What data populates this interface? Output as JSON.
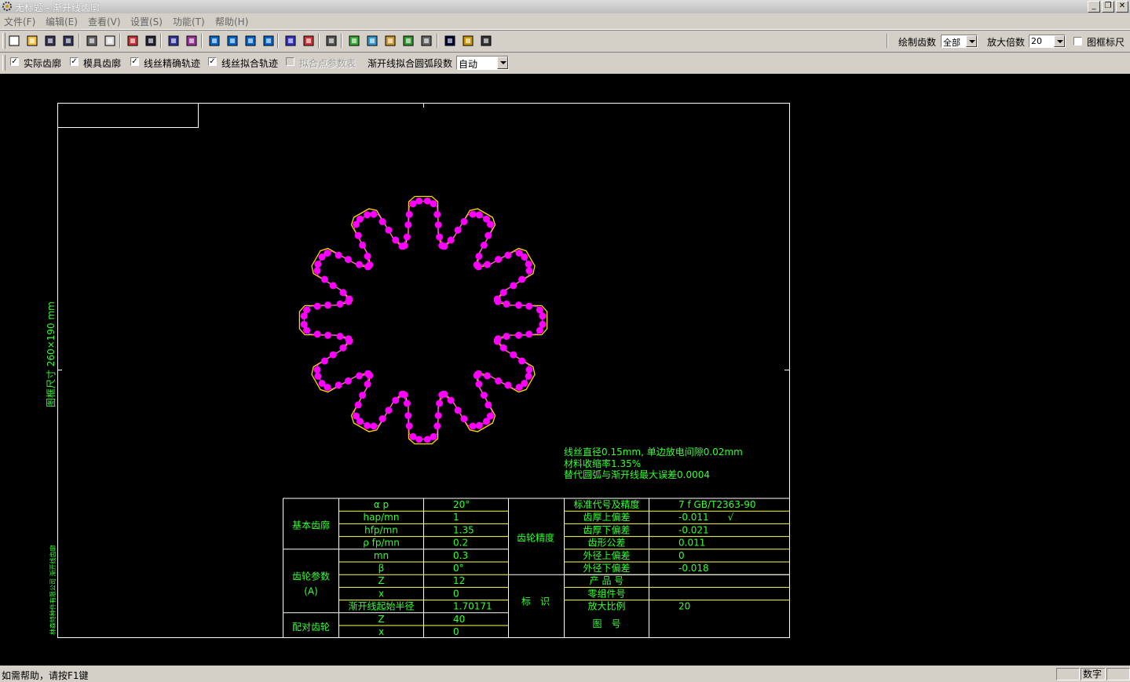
{
  "window": {
    "title": "无标题 - 渐开线齿廓"
  },
  "menu": [
    "文件(F)",
    "编辑(E)",
    "查看(V)",
    "设置(S)",
    "功能(T)",
    "帮助(H)"
  ],
  "toolbar": {
    "icons": [
      "new-icon",
      "open-icon",
      "save-icon",
      "save-all-icon",
      "print-icon",
      "print-preview-icon",
      "copy-frame-icon",
      "frame-icon",
      "dim-icon",
      "dim-alt-icon",
      "zoom-window-icon",
      "zoom-in-icon",
      "zoom-out-icon",
      "zoom-fit-icon",
      "align-icon",
      "chart-icon",
      "properties-icon",
      "image1-icon",
      "image2-icon",
      "image3-icon",
      "image4-icon",
      "image5-icon",
      "context-help-icon",
      "help-icon",
      "about-icon"
    ],
    "draw_teeth_label": "绘制齿数",
    "draw_teeth_value": "全部",
    "zoom_label": "放大倍数",
    "zoom_value": "20",
    "ruler_label": "图框标尺",
    "ruler_checked": false
  },
  "options": {
    "actual_profile": {
      "label": "实际齿廓",
      "checked": true
    },
    "die_profile": {
      "label": "模具齿廓",
      "checked": true
    },
    "wire_precise": {
      "label": "线丝精确轨迹",
      "checked": true
    },
    "wire_fit": {
      "label": "线丝拟合轨迹",
      "checked": true
    },
    "fit_params": {
      "label": "拟合点参数表",
      "checked": false,
      "disabled": true
    },
    "arc_segments_label": "渐开线拟合圆弧段数",
    "arc_segments_value": "自动"
  },
  "drawing": {
    "frame_size_label": "图框尺寸 260×190 mm",
    "company_label": "林森特种件有限公司 渐开线齿廓",
    "notes": [
      "线丝直径0.15mm, 单边放电间隙0.02mm",
      "材料收缩率1.35%",
      "替代圆弧与渐开线最大误差0.0004"
    ],
    "table": {
      "group_basic": "基本齿廓",
      "group_params": "齿轮参数",
      "group_params_sub": "(A)",
      "group_mate": "配对齿轮",
      "group_precision": "齿轮精度",
      "group_mark": "标　识",
      "rows": [
        {
          "name": "α p",
          "value": "20°"
        },
        {
          "name": "hap/mn",
          "value": "1"
        },
        {
          "name": "hfp/mn",
          "value": "1.35"
        },
        {
          "name": "ρ fp/mn",
          "value": "0.2"
        },
        {
          "name": "mn",
          "value": "0.3"
        },
        {
          "name": "β",
          "value": "0°"
        },
        {
          "name": "Z",
          "value": "12"
        },
        {
          "name": "x",
          "value": "0"
        },
        {
          "name": "渐开线起始半径",
          "value": "1.70171"
        },
        {
          "name": "Z",
          "value": "40"
        },
        {
          "name": "x",
          "value": "0"
        }
      ],
      "right_rows": [
        {
          "name": "标准代号及精度",
          "value": "7 f GB/T2363-90"
        },
        {
          "name": "齿厚上偏差",
          "value": "-0.011　　√"
        },
        {
          "name": "齿厚下偏差",
          "value": "-0.021"
        },
        {
          "name": "齿形公差",
          "value": "0.011"
        },
        {
          "name": "外径上偏差",
          "value": "0"
        },
        {
          "name": "外径下偏差",
          "value": "-0.018"
        },
        {
          "name": "产 品 号",
          "value": ""
        },
        {
          "name": "零组件号",
          "value": ""
        },
        {
          "name": "放大比例",
          "value": "20"
        },
        {
          "name": "图　号",
          "value": ""
        }
      ]
    },
    "gear": {
      "teeth": 12,
      "profile_color": "#ffd700",
      "marker_color": "#ff00ff"
    },
    "line_color": "#ffffff",
    "text_color": "#33ff33"
  },
  "status": {
    "help": "如需帮助，请按F1键",
    "num": "数字"
  }
}
